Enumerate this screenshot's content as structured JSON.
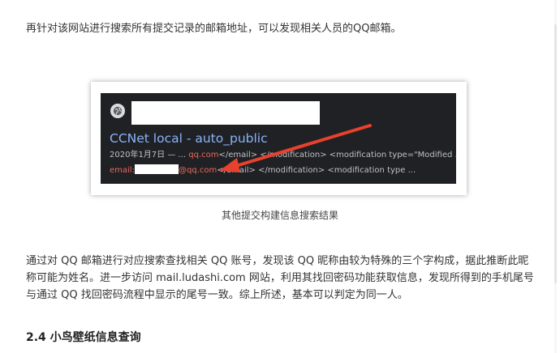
{
  "intro_text": "再针对该网站进行搜索所有提交记录的邮箱地址，可以发现相关人员的QQ邮箱。",
  "screenshot": {
    "result_title": "CCNet local - auto_public",
    "snippet_line1": {
      "prefix": "2020年1月7日 — ... ",
      "highlight": "qq.com",
      "suffix": "</email> </modification> <modification type=\"Modified ..."
    },
    "snippet_line2": {
      "prefix": "email:",
      "highlight": "@qq.com",
      "suffix": "</email> </modification> <modification type ..."
    },
    "icon": "globe-icon",
    "colors": {
      "background": "#202124",
      "title": "#8ab4f8",
      "highlight": "#ee675c",
      "arrow": "#e8412d"
    }
  },
  "caption": "其他提交构建信息搜索结果",
  "body_text": "通过对 QQ 邮箱进行对应搜索查找相关 QQ 账号，发现该 QQ 昵称由较为特殊的三个字构成，据此推断此昵称可能为姓名。进一步访问 mail.ludashi.com 网站，利用其找回密码功能获取信息，发现所得到的手机尾号与通过 QQ 找回密码流程中显示的尾号一致。综上所述，基本可以判定为同一人。",
  "section_heading": "2.4 小鸟壁纸信息查询"
}
